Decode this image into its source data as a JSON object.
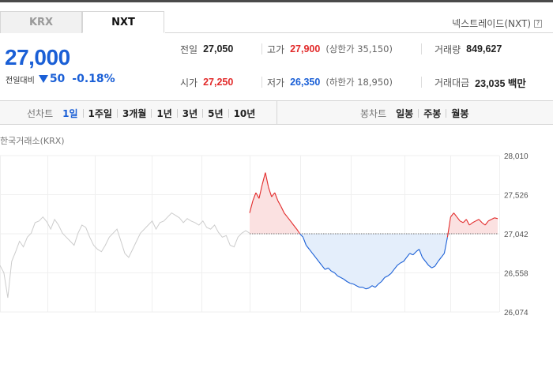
{
  "tabs": [
    {
      "label": "KRX",
      "active": false
    },
    {
      "label": "NXT",
      "active": true
    }
  ],
  "source_label": "넥스트레이드(NXT)",
  "price": {
    "current": "27,000",
    "change_label": "전일대비",
    "change": "50",
    "change_pct": "-0.18%"
  },
  "stats": {
    "prev_close": {
      "label": "전일",
      "value": "27,050"
    },
    "high": {
      "label": "고가",
      "value": "27,900",
      "sub": "(상한가 35,150)"
    },
    "volume": {
      "label": "거래량",
      "value": "849,627"
    },
    "open": {
      "label": "시가",
      "value": "27,250"
    },
    "low": {
      "label": "저가",
      "value": "26,350",
      "sub": "(하한가 18,950)"
    },
    "trade_value": {
      "label": "거래대금",
      "value": "23,035 백만"
    }
  },
  "toolbar": {
    "line_chart_label": "선차트",
    "periods": [
      "1일",
      "1주일",
      "3개월",
      "1년",
      "3년",
      "5년",
      "10년"
    ],
    "active_period": "1일",
    "candle_label": "봉차트",
    "candles": [
      "일봉",
      "주봉",
      "월봉"
    ]
  },
  "chart_caption": "한국거래소(KRX)",
  "chart_data": {
    "type": "line",
    "y_ticks": [
      "28,010",
      "27,526",
      "27,042",
      "26,558",
      "26,074"
    ],
    "ylim": [
      26074,
      28010
    ],
    "baseline": 27042,
    "series": [
      {
        "role": "krx-reference",
        "color": "#cccccc",
        "values": [
          26650,
          26560,
          26250,
          26700,
          26820,
          26950,
          26880,
          27000,
          27050,
          27180,
          27200,
          27250,
          27190,
          27100,
          27220,
          27150,
          27050,
          27000,
          26950,
          26900,
          27050,
          27150,
          27120,
          27000,
          26900,
          26850,
          26820,
          26900,
          27000,
          27050,
          27100,
          26950,
          26800,
          26750,
          26850,
          26950,
          27050,
          27100,
          27150,
          27200,
          27100,
          27180,
          27200,
          27250,
          27300,
          27270,
          27240,
          27180,
          27230,
          27200,
          27180,
          27150,
          27200,
          27120,
          27100,
          27150,
          27060,
          27000,
          27020,
          26900,
          26880,
          27000,
          27050,
          27080,
          27050
        ]
      },
      {
        "role": "nxt-day",
        "color_up": "#e22a2a",
        "color_down": "#1a5fd6",
        "values": [
          27300,
          27450,
          27550,
          27480,
          27650,
          27800,
          27620,
          27500,
          27550,
          27450,
          27380,
          27300,
          27250,
          27200,
          27150,
          27100,
          27042,
          27000,
          26900,
          26850,
          26800,
          26750,
          26700,
          26650,
          26600,
          26620,
          26580,
          26560,
          26520,
          26500,
          26480,
          26450,
          26430,
          26420,
          26400,
          26380,
          26380,
          26360,
          26370,
          26400,
          26380,
          26420,
          26450,
          26500,
          26520,
          26550,
          26600,
          26650,
          26680,
          26700,
          26750,
          26800,
          26780,
          26820,
          26850,
          26750,
          26700,
          26650,
          26620,
          26640,
          26700,
          26750,
          26800,
          27000,
          27250,
          27300,
          27250,
          27200,
          27180,
          27220,
          27150,
          27180,
          27200,
          27220,
          27180,
          27150,
          27200,
          27220,
          27240,
          27230
        ]
      }
    ],
    "grid": true
  }
}
